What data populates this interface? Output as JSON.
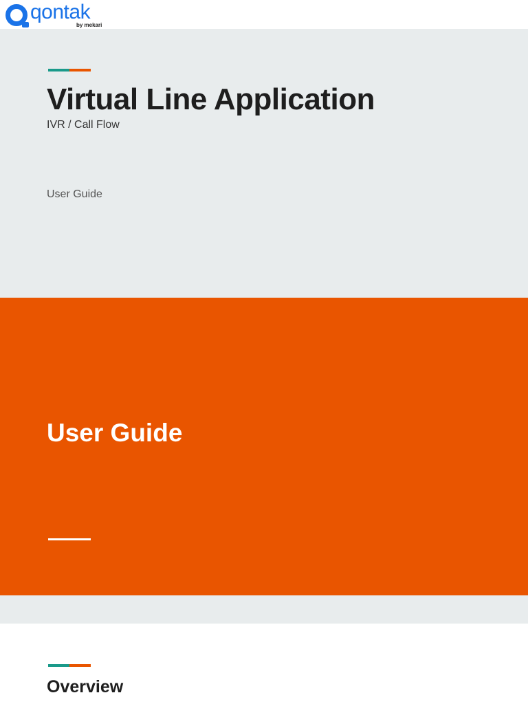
{
  "logo": {
    "name": "qontak",
    "sub": "by mekari"
  },
  "cover": {
    "title": "Virtual Line Application",
    "subtitle": "IVR / Call Flow",
    "label": "User Guide"
  },
  "section": {
    "title": "User Guide"
  },
  "next": {
    "title": "Overview"
  },
  "colors": {
    "teal": "#1a9a8a",
    "orange": "#e95500",
    "brand": "#1a73e8"
  }
}
